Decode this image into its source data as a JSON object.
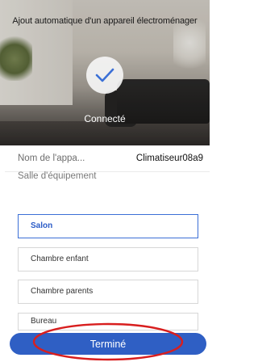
{
  "header": {
    "title": "Ajout automatique d'un appareil électroménager",
    "status": "Connecté",
    "status_icon": "check-icon",
    "accent_color": "#3b6fd6"
  },
  "device": {
    "name_label": "Nom de l'appa...",
    "name_value": "Climatiseur08a9"
  },
  "rooms": {
    "section_label": "Salle d'équipement",
    "items": [
      {
        "label": "Salon",
        "selected": true
      },
      {
        "label": "Chambre enfant",
        "selected": false
      },
      {
        "label": "Chambre parents",
        "selected": false
      },
      {
        "label": "Bureau",
        "selected": false
      }
    ]
  },
  "footer": {
    "done_label": "Terminé",
    "button_color": "#2f5fc4",
    "annotation_color": "#d81e1e"
  }
}
